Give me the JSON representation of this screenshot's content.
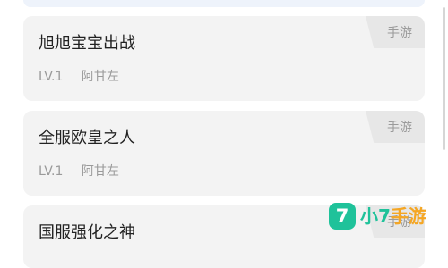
{
  "list": {
    "items": [
      {
        "title": "旭旭宝宝出战",
        "level": "LV.1",
        "game": "阿甘左",
        "tag": "手游"
      },
      {
        "title": "全服欧皇之人",
        "level": "LV.1",
        "game": "阿甘左",
        "tag": "手游"
      },
      {
        "title": "国服强化之神",
        "level": "",
        "game": "",
        "tag": "手游"
      }
    ]
  },
  "watermark": {
    "logo_glyph": "7",
    "text_prefix": "小7",
    "text_accent": "手游",
    "colors": {
      "green": "#1fc29a",
      "orange": "#f5a623"
    }
  }
}
